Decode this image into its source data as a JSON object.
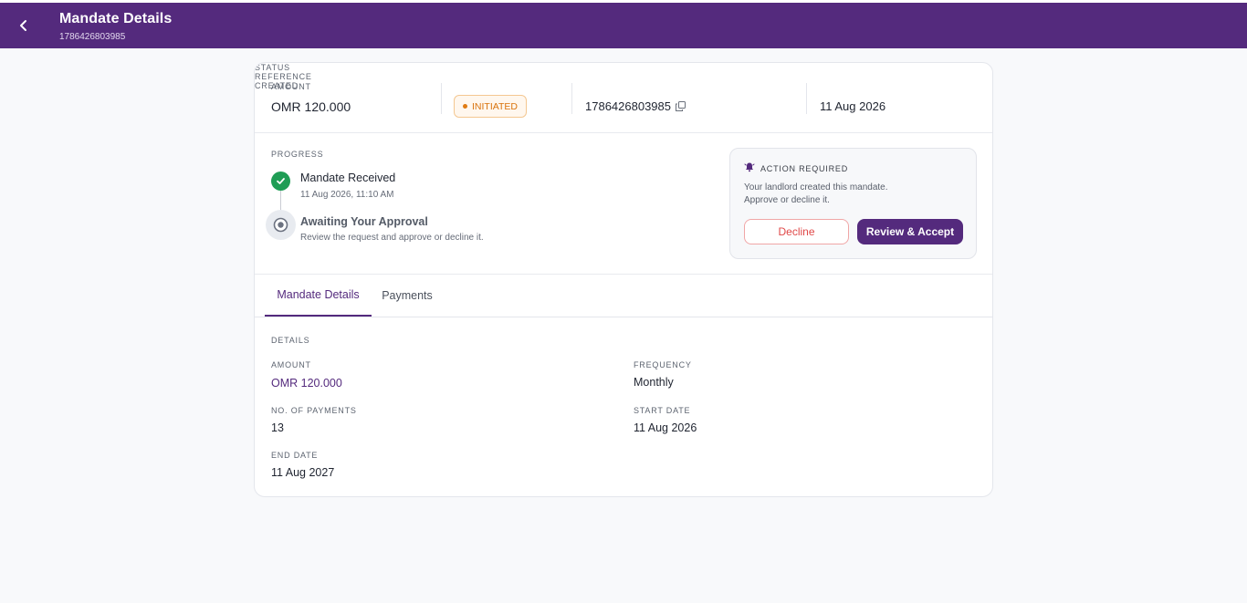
{
  "header": {
    "title": "Mandate Details",
    "subtitle": "1786426803985"
  },
  "summary": {
    "amount_label": "AMOUNT",
    "amount_value": "OMR 120.000",
    "status_label": "STATUS",
    "status_value": "INITIATED",
    "reference_label": "REFERENCE",
    "reference_value": "1786426803985",
    "created_label": "CREATED",
    "created_value": "11 Aug 2026"
  },
  "progress": {
    "label": "PROGRESS",
    "steps": [
      {
        "title": "Mandate Received",
        "subtitle": "11 Aug 2026, 11:10 AM"
      },
      {
        "title": "Awaiting Your Approval",
        "subtitle": "Review the request and approve or decline it."
      }
    ]
  },
  "action": {
    "label": "ACTION REQUIRED",
    "line1": "Your landlord created this mandate.",
    "line2": "Approve or decline it.",
    "decline_label": "Decline",
    "accept_label": "Review & Accept"
  },
  "tabs": [
    {
      "label": "Mandate Details",
      "active": true
    },
    {
      "label": "Payments",
      "active": false
    }
  ],
  "details": {
    "section_label": "DETAILS",
    "amount_label": "AMOUNT",
    "amount_value": "OMR 120.000",
    "frequency_label": "FREQUENCY",
    "frequency_value": "Monthly",
    "payments_label": "NO. OF PAYMENTS",
    "payments_value": "13",
    "start_label": "START DATE",
    "start_value": "11 Aug 2026",
    "end_label": "END DATE",
    "end_value": "11 Aug 2027"
  },
  "colors": {
    "brand": "#542a7d",
    "success": "#1f9d55",
    "warning": "#d9730d",
    "danger": "#e04848"
  },
  "icons": {
    "back": "chevron-left-icon",
    "copy": "copy-icon",
    "check": "check-icon",
    "pending": "radio-pending-icon",
    "alert": "bell-alert-icon"
  }
}
